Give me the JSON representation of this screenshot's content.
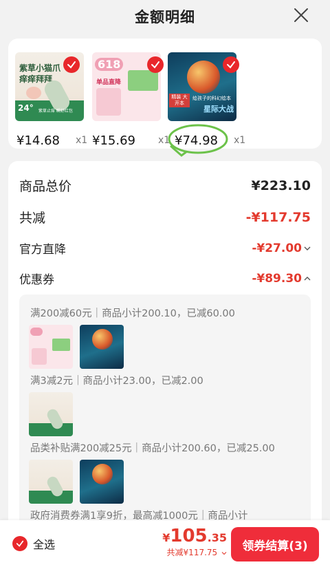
{
  "header": {
    "title": "金额明细",
    "close_icon": "close-icon"
  },
  "products": [
    {
      "name": "紫草小猫爪痒痒拜拜",
      "thumb_title_1": "紫草小猫爪",
      "thumb_title_2": "痒痒拜拜",
      "thumb_badge": "24°",
      "thumb_caption": "紫草止痒 瞬舒红包",
      "price": "¥14.68",
      "qty": "x1"
    },
    {
      "name": "618 单品直降",
      "thumb_badge": "618",
      "thumb_line": "单品直降",
      "price": "¥15.69",
      "qty": "x1"
    },
    {
      "name": "给孩子的科幻绘本 星际大战",
      "thumb_line": "给孩子的科幻绘本",
      "thumb_title": "星际大战",
      "thumb_tag": "精装 大开本",
      "price": "¥74.98",
      "qty": "x1"
    }
  ],
  "summary": {
    "total_label": "商品总价",
    "total_value": "¥223.10",
    "reduce_label": "共减",
    "reduce_value": "-¥117.75",
    "official_label": "官方直降",
    "official_value": "-¥27.00",
    "coupon_label": "优惠券",
    "coupon_value": "-¥89.30"
  },
  "coupon_details": [
    {
      "text": "满200减60元｜商品小计200.10，已减60.00"
    },
    {
      "text": "满3减2元｜商品小计23.00，已减2.00"
    },
    {
      "text": "品类补贴满200减25元｜商品小计200.60，已减25.00"
    },
    {
      "text": "政府消费券满1享9折，最高减1000元｜商品小计"
    }
  ],
  "bottom": {
    "select_all_label": "全选",
    "currency": "¥",
    "amount_int": "105",
    "amount_dec": ".35",
    "saved_text": "共减¥117.75",
    "checkout_label": "领券结算(3)"
  },
  "colors": {
    "accent": "#e8272b",
    "price_red": "#e33a2e",
    "button": "#ef2d3a",
    "green": "#2f8a52"
  }
}
